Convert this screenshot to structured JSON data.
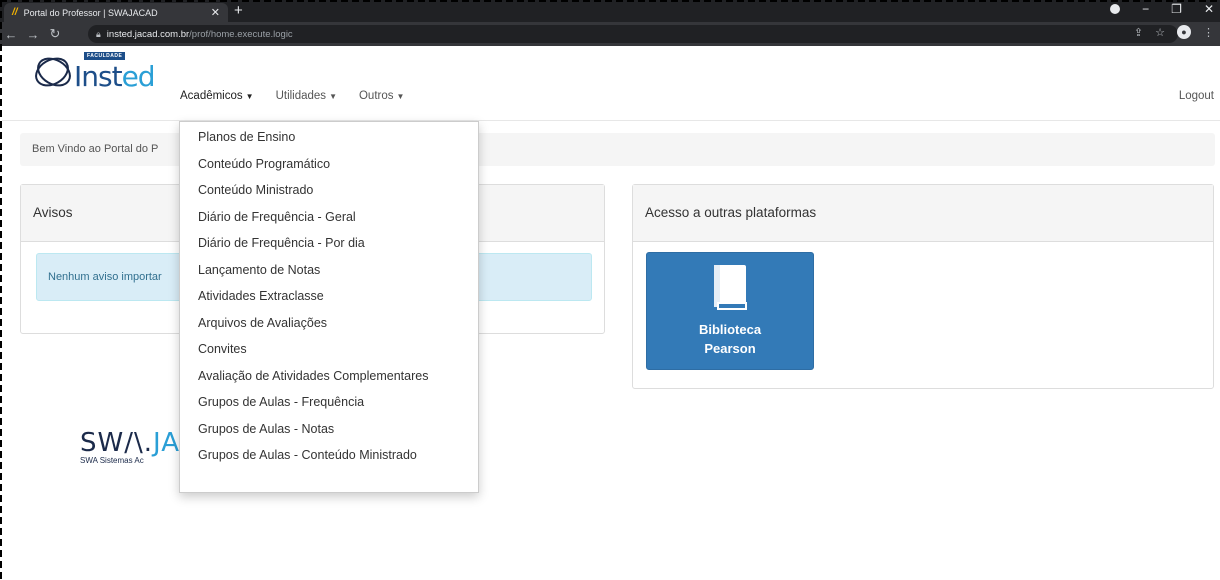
{
  "browser": {
    "tab_title": "Portal do Professor | SWAJACAD",
    "new_tab": "+",
    "url_host": "insted.jacad.com.br",
    "url_path": "/prof/home.execute.logic"
  },
  "navbar": {
    "logo_tag": "FACULDADE",
    "logo_main": "Inst",
    "logo_accent": "ed",
    "menus": [
      {
        "label": "Acadêmicos"
      },
      {
        "label": "Utilidades"
      },
      {
        "label": "Outros"
      }
    ],
    "logout": "Logout"
  },
  "breadcrumb": "Bem Vindo ao Portal do P",
  "avisos": {
    "title": "Avisos",
    "alert": "Nenhum aviso importar"
  },
  "outras": {
    "title": "Acesso a outras plataformas",
    "tile_line1": "Biblioteca",
    "tile_line2": "Pearson",
    "tile_icon": "book-icon",
    "tile_color": "#337ab7"
  },
  "footer": {
    "swa_main": "SW/\\.",
    "swa_accent": "JA",
    "swa_sub": "SWA Sistemas Ac"
  },
  "dropdown": {
    "items": [
      "Planos de Ensino",
      "Conteúdo Programático",
      "Conteúdo Ministrado",
      "Diário de Frequência - Geral",
      "Diário de Frequência - Por dia",
      "Lançamento de Notas",
      "Atividades Extraclasse",
      "Arquivos de Avaliações",
      "Convites",
      "Avaliação de Atividades Complementares",
      "Grupos de Aulas - Frequência",
      "Grupos de Aulas - Notas",
      "Grupos de Aulas - Conteúdo Ministrado"
    ]
  },
  "colors": {
    "brand": "#1d4e89",
    "accent": "#2a9fd6",
    "alert_bg": "#d9edf7"
  }
}
